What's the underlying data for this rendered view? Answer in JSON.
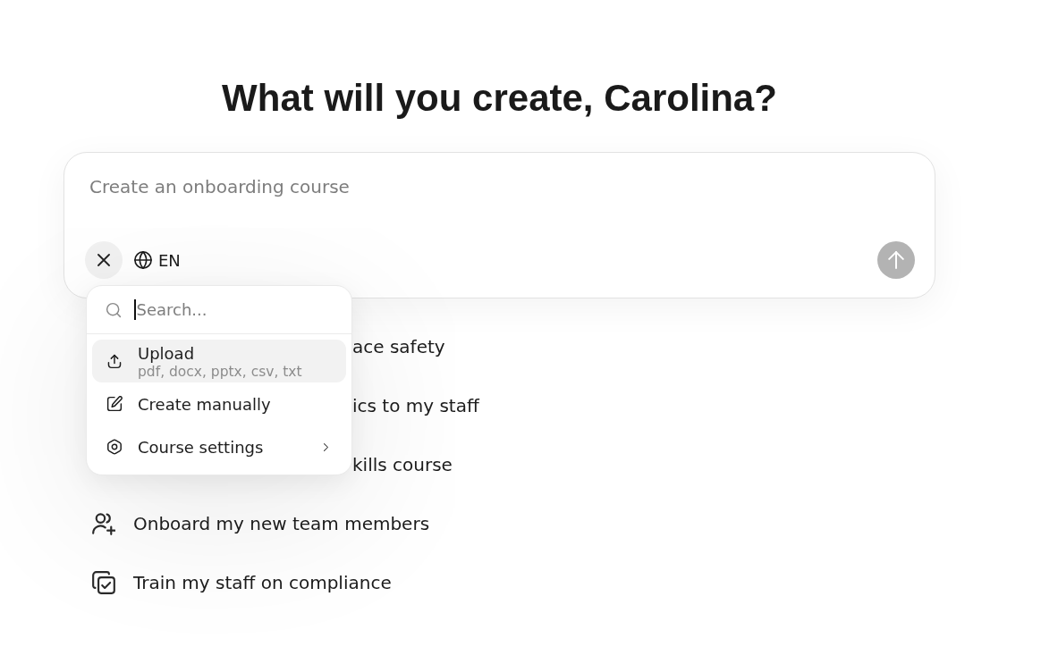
{
  "heading": "What will you create, Carolina?",
  "prompt": {
    "placeholder": "Create an onboarding course",
    "language": "EN",
    "send_disabled": true
  },
  "menu": {
    "search_placeholder": "Search...",
    "items": [
      {
        "label": "Upload",
        "hint": "pdf, docx, pptx, csv, txt",
        "selected": true,
        "submenu": false
      },
      {
        "label": "Create manually",
        "selected": false,
        "submenu": false
      },
      {
        "label": "Course settings",
        "selected": false,
        "submenu": true
      }
    ]
  },
  "suggestions": [
    {
      "kind": "covered",
      "label": "ace safety"
    },
    {
      "kind": "covered",
      "label": "ics to my staff"
    },
    {
      "kind": "covered",
      "label": "kills course"
    },
    {
      "kind": "full",
      "label": "Onboard my new team members"
    },
    {
      "kind": "full",
      "label": "Train my staff on compliance"
    }
  ]
}
